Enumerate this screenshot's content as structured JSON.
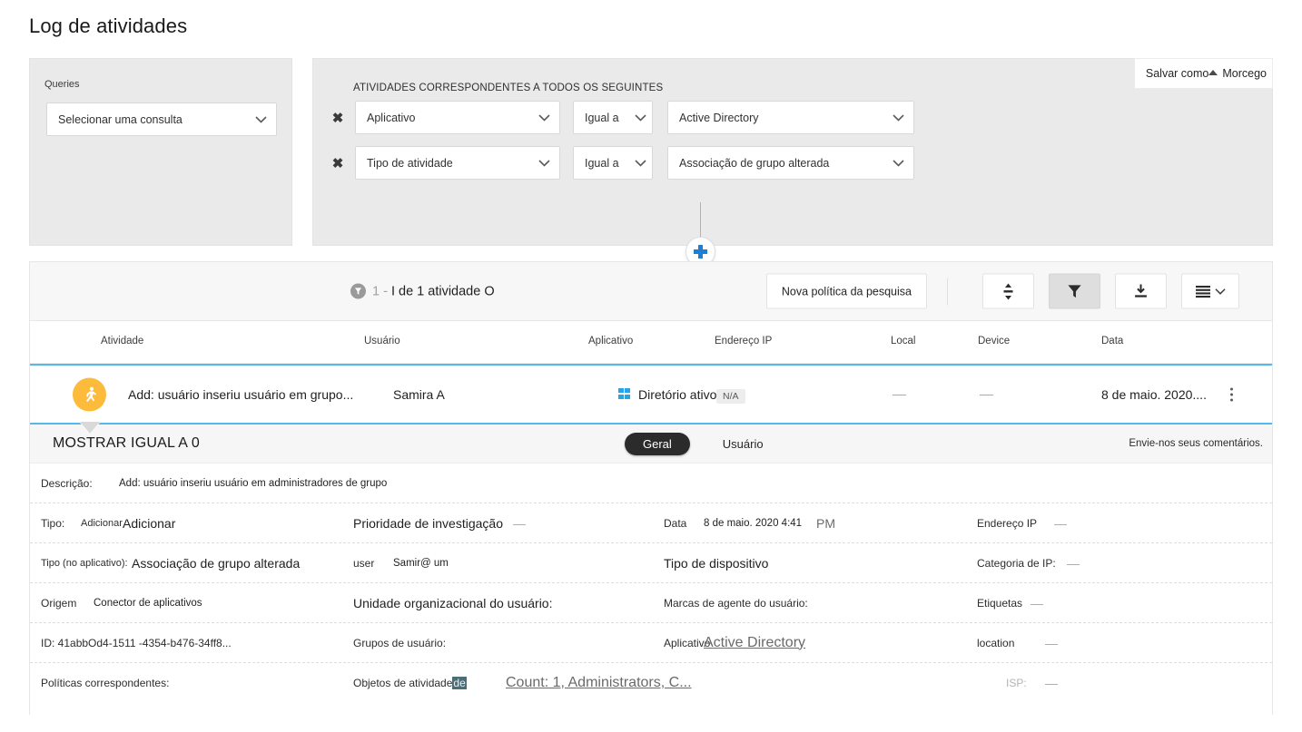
{
  "page": {
    "title": "Log de atividades"
  },
  "queries": {
    "label": "Queries",
    "select_value": "Selecionar uma consulta"
  },
  "filters": {
    "heading": "ATIVIDADES CORRESPONDENTES A TODOS OS SEGUINTES",
    "rows": [
      {
        "field": "Aplicativo",
        "operator": "Igual a",
        "value": "Active Directory",
        "remove_icon": "close-x-icon"
      },
      {
        "field": "Tipo de atividade",
        "operator": "Igual a",
        "value": "Associação de grupo alterada",
        "remove_icon": "close-x-icon"
      }
    ],
    "add_icon": "plus-icon",
    "save_as": {
      "label": "Salvar como",
      "secondary": "Morcego",
      "caret_icon": "caret-up-icon"
    }
  },
  "toolbar": {
    "count_prefix": "1 -",
    "count_text": "I de 1 atividade O",
    "count_icon": "filter-badge-icon",
    "new_policy_label": "Nova política da pesquisa",
    "icons": [
      {
        "name": "sort-updown-icon",
        "active": false
      },
      {
        "name": "filter-funnel-icon",
        "active": true
      },
      {
        "name": "download-icon",
        "active": false
      },
      {
        "name": "list-view-icon",
        "active": false
      }
    ]
  },
  "table": {
    "columns": [
      "Atividade",
      "Usuário",
      "Aplicativo",
      "Endereço IP",
      "Local",
      "Device",
      "Data"
    ],
    "row": {
      "icon": "running-person-icon",
      "activity": "Add: usuário inseriu usuário em grupo...",
      "user": "Samira A",
      "app": "Diretório ativo...",
      "app_icon": "windows-logo-icon",
      "ip": "N/A",
      "local": "—",
      "device": "—",
      "date": "8 de maio. 2020....",
      "more_icon": "kebab-menu-icon"
    }
  },
  "detail": {
    "title": "MOSTRAR IGUAL A 0",
    "tabs": [
      {
        "label": "Geral",
        "active": true
      },
      {
        "label": "Usuário",
        "active": false
      }
    ],
    "feedback": "Envie-nos seus comentários.",
    "rows": [
      {
        "c1_label": "Descrição:",
        "c1_value": "Add: usuário inseriu usuário em administradores de grupo"
      },
      {
        "c1_label": "Tipo:",
        "c1_small": "Adicionar",
        "c1_value": "Adicionar",
        "c2_label": "Prioridade de investigação",
        "c2_value": "—",
        "c3_label": "Data",
        "c3_value": "8 de maio. 2020 4:41",
        "c3_suffix": "PM",
        "c4_label": "Endereço IP",
        "c4_value": "—"
      },
      {
        "c1_label": "Tipo (no aplicativo):",
        "c1_value": "Associação de grupo alterada",
        "c2_label": "user",
        "c2_value": "Samir@ um",
        "c3_label": "Tipo de dispositivo",
        "c4_label": "Categoria de IP:",
        "c4_value": "—"
      },
      {
        "c1_label": "Origem",
        "c1_value": "Conector de aplicativos",
        "c2_label": "Unidade organizacional do usuário:",
        "c3_label": "Marcas de agente do usuário:",
        "c4_label": "Etiquetas",
        "c4_value": "—"
      },
      {
        "c1_label": "ID: 41abbOd4-1511 -4354-b476-34ff8...",
        "c2_label": "Grupos de usuário:",
        "c3_label": "Aplicativo",
        "c3_link": "Active Directory",
        "c4_label": "location",
        "c4_value": "—"
      },
      {
        "c1_label": "Políticas correspondentes:",
        "c2_label": "Objetos de atividade",
        "c2_highlight": "de",
        "c2_link": "Count: 1, Administrators, C...",
        "c4_label": "ISP:",
        "c4_value": "—"
      }
    ]
  },
  "colors": {
    "accent_blue": "#1c7fd6",
    "row_select_border": "#53b9e8",
    "activity_icon_bg": "#fdbb3c",
    "panel_bg": "#eaeaea",
    "tab_active_bg": "#2b2b2b"
  }
}
